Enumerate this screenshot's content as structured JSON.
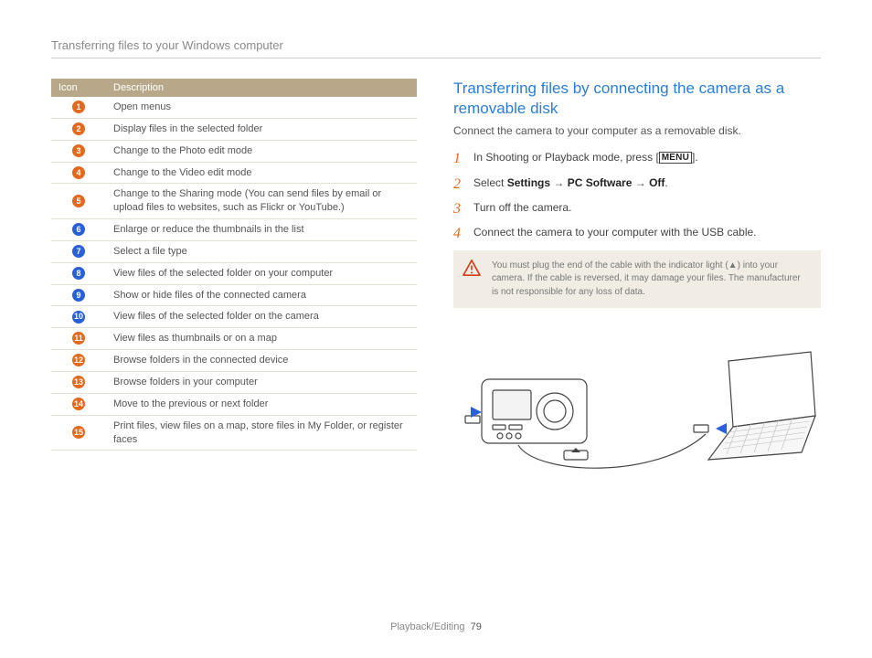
{
  "header": {
    "title": "Transferring files to your Windows computer"
  },
  "table": {
    "head_icon": "Icon",
    "head_desc": "Description",
    "rows": [
      {
        "n": "1",
        "color": "orange",
        "desc": "Open menus"
      },
      {
        "n": "2",
        "color": "orange",
        "desc": "Display files in the selected folder"
      },
      {
        "n": "3",
        "color": "orange",
        "desc": "Change to the Photo edit mode"
      },
      {
        "n": "4",
        "color": "orange",
        "desc": "Change to the Video edit mode"
      },
      {
        "n": "5",
        "color": "orange",
        "desc": "Change to the Sharing mode (You can send files by email or upload files to websites, such as Flickr or YouTube.)"
      },
      {
        "n": "6",
        "color": "blue",
        "desc": "Enlarge or reduce the thumbnails in the list"
      },
      {
        "n": "7",
        "color": "blue",
        "desc": "Select a file type"
      },
      {
        "n": "8",
        "color": "blue",
        "desc": "View files of the selected folder on your computer"
      },
      {
        "n": "9",
        "color": "blue",
        "desc": "Show or hide files of the connected camera"
      },
      {
        "n": "10",
        "color": "blue",
        "desc": "View files of the selected folder on the camera"
      },
      {
        "n": "11",
        "color": "orange",
        "desc": "View files as thumbnails or on a map"
      },
      {
        "n": "12",
        "color": "orange",
        "desc": "Browse folders in the connected device"
      },
      {
        "n": "13",
        "color": "orange",
        "desc": "Browse folders in your computer"
      },
      {
        "n": "14",
        "color": "orange",
        "desc": "Move to the previous or next folder"
      },
      {
        "n": "15",
        "color": "orange",
        "desc": "Print files, view files on a map, store files in My Folder, or register faces"
      }
    ]
  },
  "section": {
    "title": "Transferring files by connecting the camera as a removable disk",
    "intro": "Connect the camera to your computer as a removable disk.",
    "steps": {
      "s1_a": "In Shooting or Playback mode, press [",
      "s1_menu": "MENU",
      "s1_b": "].",
      "s2_a": "Select ",
      "s2_b1": "Settings",
      "s2_arrow1": " → ",
      "s2_b2": "PC Software",
      "s2_arrow2": " → ",
      "s2_b3": "Off",
      "s2_c": ".",
      "s3": "Turn off the camera.",
      "s4": "Connect the camera to your computer with the USB cable."
    },
    "callout": "You must plug the end of the cable with the indicator light (▲) into your camera. If the cable is reversed, it may damage your files. The manufacturer is not responsible for any loss of data."
  },
  "footer": {
    "section": "Playback/Editing",
    "page": "79"
  }
}
